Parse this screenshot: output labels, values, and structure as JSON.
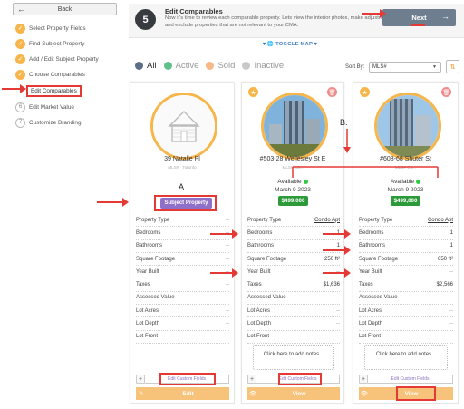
{
  "sidebar": {
    "back_label": "Back",
    "steps": [
      {
        "label": "Select Property Fields",
        "state": "done",
        "marker": "✓"
      },
      {
        "label": "Find Subject Property",
        "state": "done",
        "marker": "✓"
      },
      {
        "label": "Add / Edit Subject Property",
        "state": "done",
        "marker": "✓"
      },
      {
        "label": "Choose Comparables",
        "state": "done",
        "marker": "✓"
      },
      {
        "label": "Edit Comparables",
        "state": "current",
        "marker": ""
      },
      {
        "label": "Edit Market Value",
        "state": "todo",
        "marker": "6"
      },
      {
        "label": "Customize Branding",
        "state": "todo",
        "marker": "7"
      }
    ]
  },
  "banner": {
    "step_number": "5",
    "title": "Edit Comparables",
    "description": "Now it's time to review each comparable property. Lets view the interior photos, make adjustments and exclude properties that are not relevant to your CMA.",
    "next_label": "Next",
    "next_arrow": "→"
  },
  "toggle_map_label": "▾ 🌐 TOGGLE MAP ▾",
  "filters": [
    {
      "label": "All",
      "color": "#5b6f8a",
      "selected": true
    },
    {
      "label": "Active",
      "color": "#5fc08a",
      "selected": false
    },
    {
      "label": "Sold",
      "color": "#f7b88a",
      "selected": false
    },
    {
      "label": "Inactive",
      "color": "#c8c8c8",
      "selected": false
    }
  ],
  "sort": {
    "label": "Sort By:",
    "value": "MLS#",
    "chevron": "▼",
    "button_icon": "⇅"
  },
  "annotations": {
    "label_a": "A",
    "label_b": "B."
  },
  "colors": {
    "accent": "#f7b64c",
    "next": "#6e7e8f",
    "subject": "#8e6fc9",
    "price": "#2d9a3a",
    "annotation": "#e53935"
  },
  "row_labels": [
    "Property Type",
    "Bedrooms",
    "Bathrooms",
    "Square Footage",
    "Year Built",
    "Taxes",
    "Assessed Value",
    "Lot Acres",
    "Lot Depth",
    "Lot Front"
  ],
  "cards": [
    {
      "address": "39 Natalie Pl",
      "subline": "MLS# · Toronto",
      "badge": "Subject Property",
      "values": [
        "--",
        "--",
        "--",
        "--",
        "--",
        "--",
        "--",
        "--",
        "--",
        "--"
      ],
      "custom_fields": "Edit Custom Fields",
      "action": "Edit",
      "action_icon": "✎",
      "photo_alt": "No photo available"
    },
    {
      "address": "#503-28 Wellesley St E",
      "subline": "MLS# C5...",
      "status": "Available",
      "date": "March 9 2023",
      "price": "$499,000",
      "values": [
        "Condo Apt",
        "1",
        "1",
        "250 ft²",
        "--",
        "$1,636",
        "--",
        "--",
        "--",
        "--"
      ],
      "notes": "Click here to add notes...",
      "custom_fields": "Edit Custom Fields",
      "action": "View",
      "action_icon": "👁",
      "fav_icon": "★",
      "delete_icon": "🗑"
    },
    {
      "address": "#608-68 Shuter St",
      "subline": "MLS# C5...",
      "status": "Available",
      "date": "March 9 2023",
      "price": "$499,000",
      "values": [
        "Condo Apt",
        "1",
        "1",
        "650 ft²",
        "--",
        "$2,566",
        "--",
        "--",
        "--",
        "--"
      ],
      "notes": "Click here to add notes...",
      "custom_fields": "Edit Custom Fields",
      "action": "View",
      "action_icon": "👁",
      "fav_icon": "★",
      "delete_icon": "🗑"
    }
  ]
}
